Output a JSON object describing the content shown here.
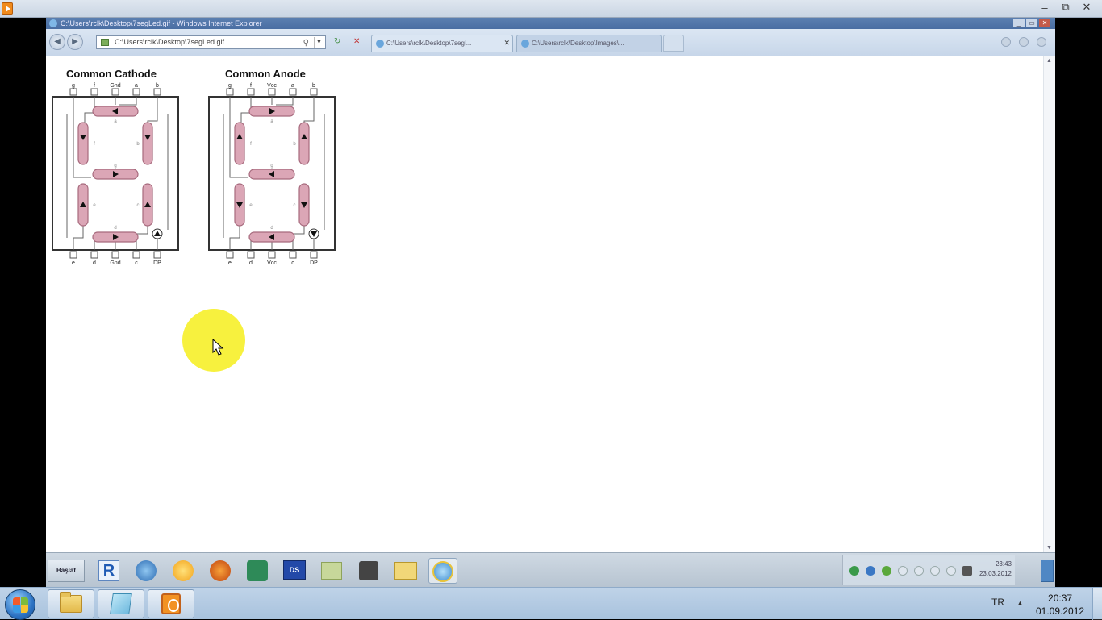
{
  "outer_window": {
    "title": "",
    "controls": {
      "minimize": "–",
      "restore": "⧉",
      "close": "✕"
    }
  },
  "browser": {
    "title": "C:\\Users\\rclk\\Desktop\\7segLed.gif - Windows Internet Explorer",
    "address": "C:\\Users\\rclk\\Desktop\\7segLed.gif",
    "tabs": [
      {
        "label": "C:\\Users\\rclk\\Desktop\\7segl...",
        "close": "✕"
      },
      {
        "label": "C:\\Users\\rclk\\Desktop\\Images\\..."
      }
    ]
  },
  "diagram": {
    "cathode": {
      "title": "Common Cathode",
      "top_pins": [
        "g",
        "f",
        "Gnd",
        "a",
        "b"
      ],
      "bottom_pins": [
        "e",
        "d",
        "Gnd",
        "c",
        "DP"
      ],
      "segment_letters": [
        "a",
        "b",
        "c",
        "d",
        "e",
        "f",
        "g"
      ]
    },
    "anode": {
      "title": "Common Anode",
      "top_pins": [
        "g",
        "f",
        "Vcc",
        "a",
        "b"
      ],
      "bottom_pins": [
        "e",
        "d",
        "Vcc",
        "c",
        "DP"
      ],
      "segment_letters": [
        "a",
        "b",
        "c",
        "d",
        "e",
        "f",
        "g"
      ]
    }
  },
  "inner_taskbar": {
    "start_label": "Başlat",
    "time": "23:43",
    "date": "23.03.2012"
  },
  "taskbar": {
    "language": "TR",
    "time": "20:37",
    "date": "01.09.2012"
  },
  "colors": {
    "segment_fill": "#dba6b6",
    "segment_stroke": "#a76a7d",
    "highlight": "#f7f034",
    "taskbar": "#b5cbe3"
  }
}
